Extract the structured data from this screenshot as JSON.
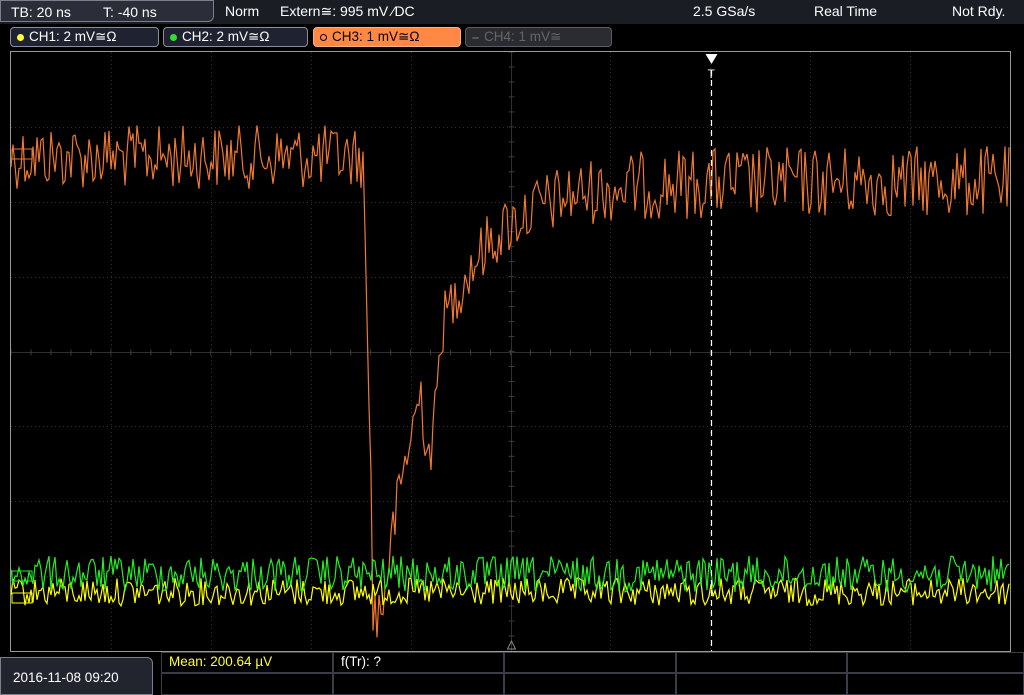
{
  "topbar": {
    "timebase": "TB: 20 ns",
    "trigger_time": "T: -40 ns",
    "acq_mode": "Norm",
    "trigger_source": "Extern≅: 995 mV ⁄DC",
    "sample_rate": "2.5 GSa/s",
    "mode": "Real Time",
    "status": "Not Rdy."
  },
  "channels": [
    {
      "label": "CH1: 2 mV≅Ω",
      "color": "#ffff33",
      "active": true
    },
    {
      "label": "CH2: 2 mV≅Ω",
      "color": "#33dd33",
      "active": true
    },
    {
      "label": "CH3: 1 mV≅Ω",
      "color": "#ff8844",
      "active": true,
      "selected": true
    },
    {
      "label": "CH4: 1 mV≅",
      "color": "#777777",
      "active": false
    }
  ],
  "trace_colors": {
    "ch1": "#ffff00",
    "ch2": "#22ee22",
    "ch3": "#f07830"
  },
  "measurements": {
    "mean": "Mean: 200.64 µV",
    "ftr": "f(Tr): ?"
  },
  "datetime": "2016-11-08 09:20"
}
